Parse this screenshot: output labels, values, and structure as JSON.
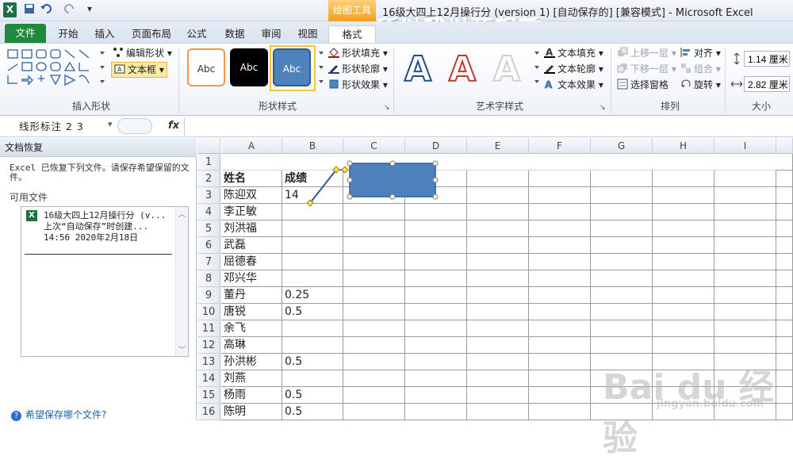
{
  "titlebar": {
    "title": "16级大四上12月操行分 (version 1) [自动保存的]  [兼容模式] - Microsoft Excel",
    "context_tool": "绘图工具",
    "overlay_caption": "所以我以死起誓"
  },
  "tabs": [
    "文件",
    "开始",
    "插入",
    "页面布局",
    "公式",
    "数据",
    "审阅",
    "视图",
    "格式"
  ],
  "ribbon": {
    "insert_shapes": {
      "edit_shape": "编辑形状",
      "text_box": "文本框",
      "label": "插入形状"
    },
    "shape_styles": {
      "style_samples": [
        "Abc",
        "Abc",
        "Abc"
      ],
      "fill": "形状填充",
      "outline": "形状轮廓",
      "effects": "形状效果",
      "label": "形状样式"
    },
    "wordart": {
      "samples": [
        "A",
        "A",
        "A"
      ],
      "fill": "文本填充",
      "outline": "文本轮廓",
      "effects": "文本效果",
      "label": "艺术字样式"
    },
    "arrange": {
      "bring_forward": "上移一层",
      "send_backward": "下移一层",
      "selection_pane": "选择窗格",
      "align": "对齐",
      "group": "组合",
      "rotate": "旋转",
      "label": "排列"
    },
    "size": {
      "height": "1.14 厘米",
      "width": "2.82 厘米",
      "label": "大小"
    }
  },
  "formula_bar": {
    "name_box": "线形标注 2 3",
    "fx": "fx",
    "content": ""
  },
  "recovery_pane": {
    "title": "文档恢复",
    "message": "Excel 已恢复下列文件。请保存希望保留的文件。",
    "available_label": "可用文件",
    "file": {
      "name": "16级大四上12月操行分 (v...",
      "note": "上次“自动保存”时创建...",
      "time": "14:56 2020年2月18日"
    },
    "help_link": "希望保存哪个文件?"
  },
  "sheet": {
    "columns": [
      "A",
      "B",
      "C",
      "D",
      "E",
      "F",
      "G",
      "H",
      "I"
    ],
    "rows": [
      {
        "n": "1",
        "a": "",
        "b": ""
      },
      {
        "n": "2",
        "a": "姓名",
        "b": "成绩"
      },
      {
        "n": "3",
        "a": "陈迎双",
        "b": "14"
      },
      {
        "n": "4",
        "a": "李正敏",
        "b": ""
      },
      {
        "n": "5",
        "a": "刘洪福",
        "b": ""
      },
      {
        "n": "6",
        "a": "武磊",
        "b": ""
      },
      {
        "n": "7",
        "a": "屈德春",
        "b": ""
      },
      {
        "n": "8",
        "a": "邓兴华",
        "b": ""
      },
      {
        "n": "9",
        "a": "董丹",
        "b": "0.25"
      },
      {
        "n": "10",
        "a": "唐锐",
        "b": "0.5"
      },
      {
        "n": "11",
        "a": "余飞",
        "b": ""
      },
      {
        "n": "12",
        "a": "高琳",
        "b": ""
      },
      {
        "n": "13",
        "a": "孙洪彬",
        "b": "0.5"
      },
      {
        "n": "14",
        "a": "刘燕",
        "b": ""
      },
      {
        "n": "15",
        "a": "杨雨",
        "b": "0.5"
      },
      {
        "n": "16",
        "a": "陈明",
        "b": "0.5"
      }
    ]
  },
  "watermark": {
    "brand": "Bai du 经验",
    "url": "jingyan.baidu.com"
  },
  "colors": {
    "shape_fill": "#4f81bd",
    "file_tab": "#1f8a3e",
    "tool_tab": "#f29f1e"
  }
}
